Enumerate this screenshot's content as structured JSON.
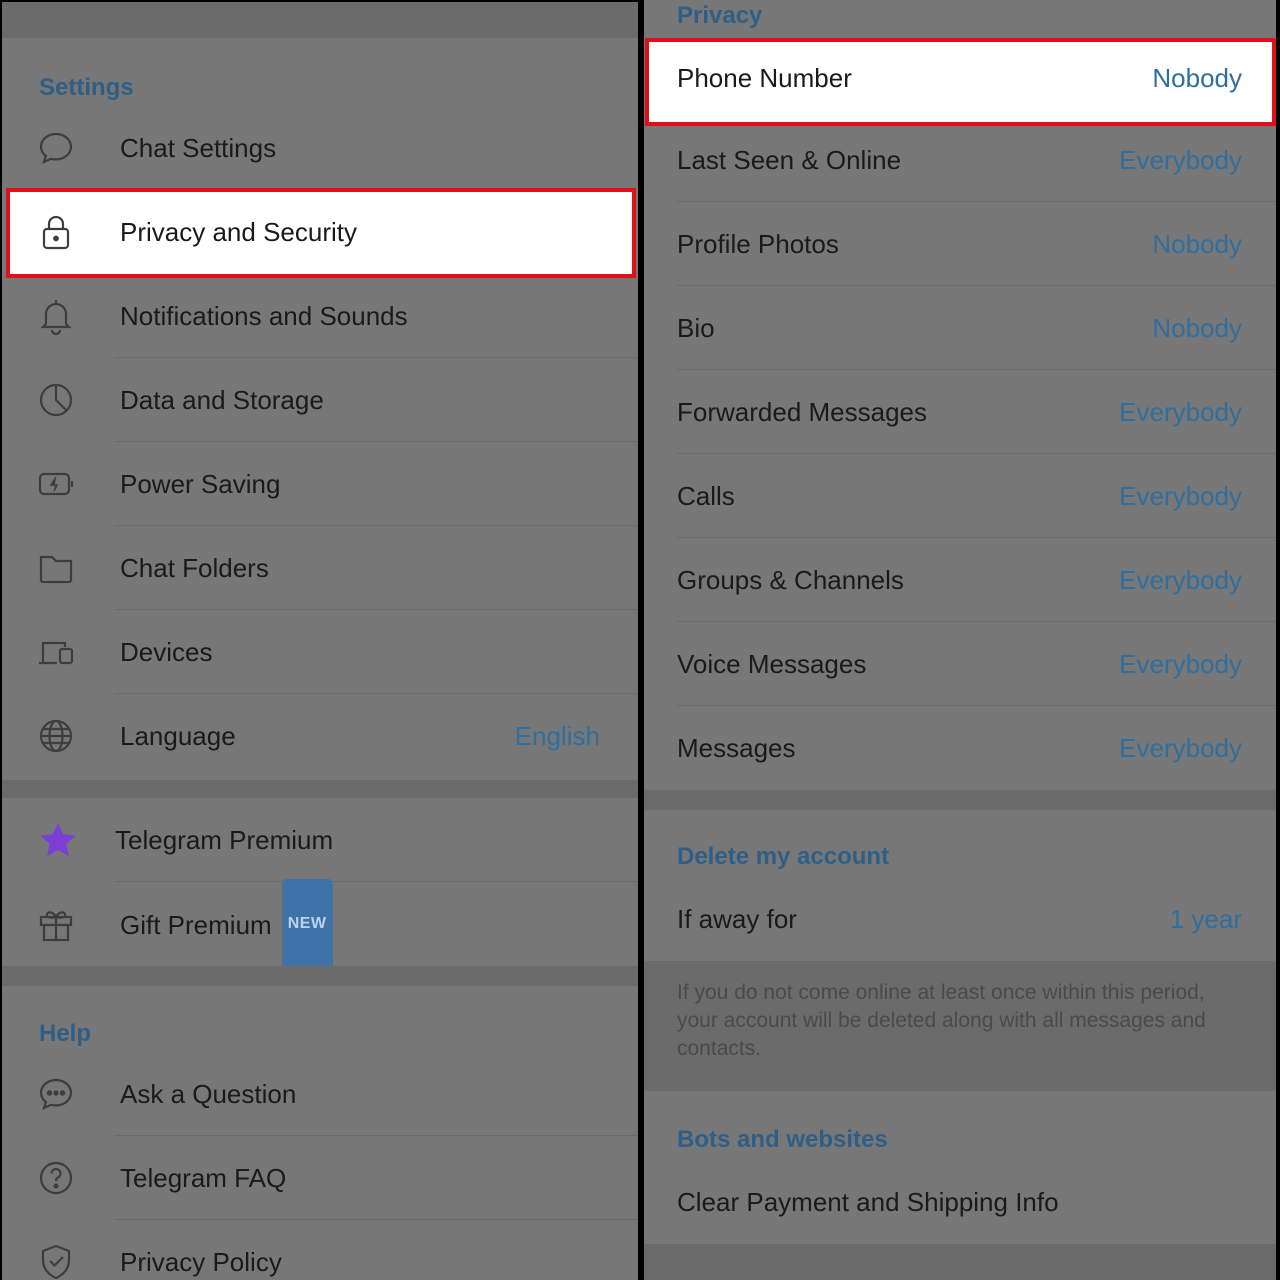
{
  "left": {
    "settings_header": "Settings",
    "items": [
      {
        "label": "Chat Settings",
        "icon": "chat-bubble-icon"
      },
      {
        "label": "Privacy and Security",
        "icon": "lock-icon"
      },
      {
        "label": "Notifications and Sounds",
        "icon": "bell-icon"
      },
      {
        "label": "Data and Storage",
        "icon": "pie-chart-icon"
      },
      {
        "label": "Power Saving",
        "icon": "battery-icon"
      },
      {
        "label": "Chat Folders",
        "icon": "folder-icon"
      },
      {
        "label": "Devices",
        "icon": "devices-icon"
      },
      {
        "label": "Language",
        "value": "English",
        "icon": "globe-icon"
      }
    ],
    "premium_items": [
      {
        "label": "Telegram Premium",
        "icon": "star-icon"
      },
      {
        "label": "Gift Premium",
        "badge": "NEW",
        "icon": "gift-icon"
      }
    ],
    "help_header": "Help",
    "help_items": [
      {
        "label": "Ask a Question",
        "icon": "chat-dots-icon"
      },
      {
        "label": "Telegram FAQ",
        "icon": "question-icon"
      },
      {
        "label": "Privacy Policy",
        "icon": "shield-check-icon"
      }
    ]
  },
  "right": {
    "privacy_header": "Privacy",
    "privacy_items": [
      {
        "label": "Phone Number",
        "value": "Nobody"
      },
      {
        "label": "Last Seen & Online",
        "value": "Everybody"
      },
      {
        "label": "Profile Photos",
        "value": "Nobody"
      },
      {
        "label": "Bio",
        "value": "Nobody"
      },
      {
        "label": "Forwarded Messages",
        "value": "Everybody"
      },
      {
        "label": "Calls",
        "value": "Everybody"
      },
      {
        "label": "Groups & Channels",
        "value": "Everybody"
      },
      {
        "label": "Voice Messages",
        "value": "Everybody"
      },
      {
        "label": "Messages",
        "value": "Everybody"
      }
    ],
    "delete_header": "Delete my account",
    "delete_item": {
      "label": "If away for",
      "value": "1 year"
    },
    "delete_info": "If you do not come online at least once within this period, your account will be deleted along with all messages and contacts.",
    "bots_header": "Bots and websites",
    "bots_item": {
      "label": "Clear Payment and Shipping Info"
    }
  },
  "colors": {
    "highlight_border": "#e0101a",
    "accent": "#2f6e9e",
    "premium_star": "#7b3fd6"
  }
}
